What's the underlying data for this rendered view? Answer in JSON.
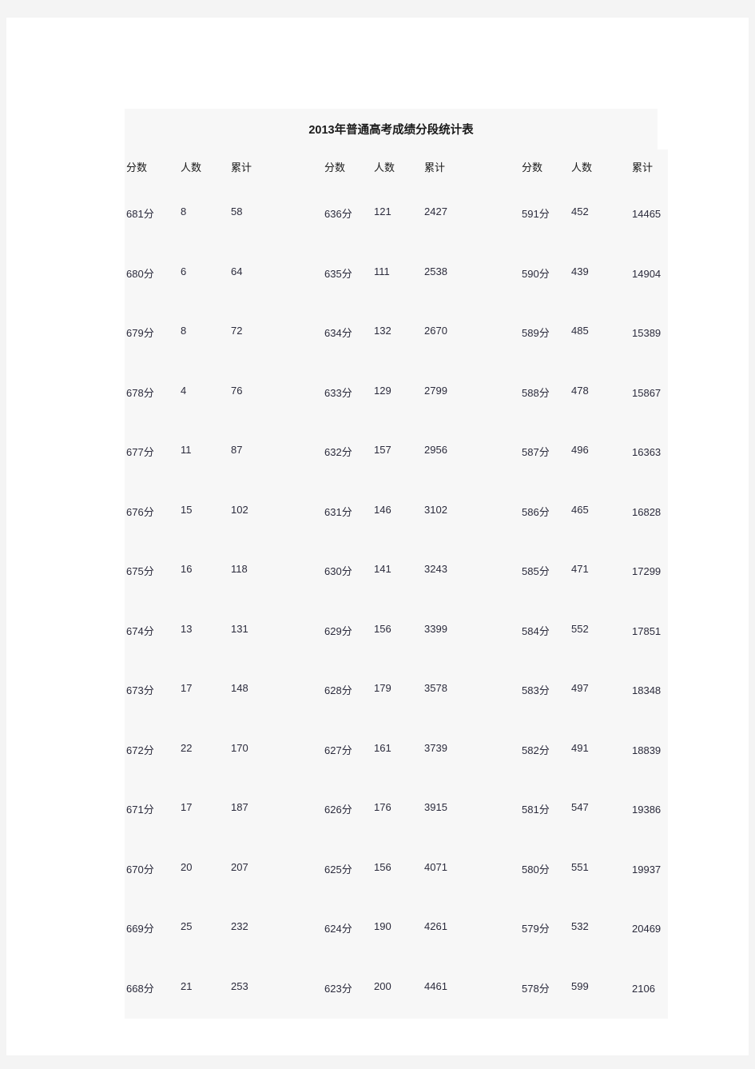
{
  "document": {
    "title": "2013年普通高考成绩分段统计表"
  },
  "table": {
    "headers": [
      "分数",
      "人数",
      "累计",
      "分数",
      "人数",
      "累计",
      "分数",
      "人数",
      "累计"
    ],
    "header_score": "分数",
    "header_count": "人数",
    "header_accum": "累计",
    "rows": [
      {
        "g1_score": "681分",
        "g1_count": "8",
        "g1_accum": "58",
        "g2_score": "636分",
        "g2_count": "121",
        "g2_accum": "2427",
        "g3_score": "591分",
        "g3_count": "452",
        "g3_accum": "14465"
      },
      {
        "g1_score": "680分",
        "g1_count": "6",
        "g1_accum": "64",
        "g2_score": "635分",
        "g2_count": "111",
        "g2_accum": "2538",
        "g3_score": "590分",
        "g3_count": "439",
        "g3_accum": "14904"
      },
      {
        "g1_score": "679分",
        "g1_count": "8",
        "g1_accum": "72",
        "g2_score": "634分",
        "g2_count": "132",
        "g2_accum": "2670",
        "g3_score": "589分",
        "g3_count": "485",
        "g3_accum": "15389"
      },
      {
        "g1_score": "678分",
        "g1_count": "4",
        "g1_accum": "76",
        "g2_score": "633分",
        "g2_count": "129",
        "g2_accum": "2799",
        "g3_score": "588分",
        "g3_count": "478",
        "g3_accum": "15867"
      },
      {
        "g1_score": "677分",
        "g1_count": "11",
        "g1_accum": "87",
        "g2_score": "632分",
        "g2_count": "157",
        "g2_accum": "2956",
        "g3_score": "587分",
        "g3_count": "496",
        "g3_accum": "16363"
      },
      {
        "g1_score": "676分",
        "g1_count": "15",
        "g1_accum": "102",
        "g2_score": "631分",
        "g2_count": "146",
        "g2_accum": "3102",
        "g3_score": "586分",
        "g3_count": "465",
        "g3_accum": "16828"
      },
      {
        "g1_score": "675分",
        "g1_count": "16",
        "g1_accum": "118",
        "g2_score": "630分",
        "g2_count": "141",
        "g2_accum": "3243",
        "g3_score": "585分",
        "g3_count": "471",
        "g3_accum": "17299"
      },
      {
        "g1_score": "674分",
        "g1_count": "13",
        "g1_accum": "131",
        "g2_score": "629分",
        "g2_count": "156",
        "g2_accum": "3399",
        "g3_score": "584分",
        "g3_count": "552",
        "g3_accum": "17851"
      },
      {
        "g1_score": "673分",
        "g1_count": "17",
        "g1_accum": "148",
        "g2_score": "628分",
        "g2_count": "179",
        "g2_accum": "3578",
        "g3_score": "583分",
        "g3_count": "497",
        "g3_accum": "18348"
      },
      {
        "g1_score": "672分",
        "g1_count": "22",
        "g1_accum": "170",
        "g2_score": "627分",
        "g2_count": "161",
        "g2_accum": "3739",
        "g3_score": "582分",
        "g3_count": "491",
        "g3_accum": "18839"
      },
      {
        "g1_score": "671分",
        "g1_count": "17",
        "g1_accum": "187",
        "g2_score": "626分",
        "g2_count": "176",
        "g2_accum": "3915",
        "g3_score": "581分",
        "g3_count": "547",
        "g3_accum": "19386"
      },
      {
        "g1_score": "670分",
        "g1_count": "20",
        "g1_accum": "207",
        "g2_score": "625分",
        "g2_count": "156",
        "g2_accum": "4071",
        "g3_score": "580分",
        "g3_count": "551",
        "g3_accum": "19937"
      },
      {
        "g1_score": "669分",
        "g1_count": "25",
        "g1_accum": "232",
        "g2_score": "624分",
        "g2_count": "190",
        "g2_accum": "4261",
        "g3_score": "579分",
        "g3_count": "532",
        "g3_accum": "20469"
      },
      {
        "g1_score": "668分",
        "g1_count": "21",
        "g1_accum": "253",
        "g2_score": "623分",
        "g2_count": "200",
        "g2_accum": "4461",
        "g3_score": "578分",
        "g3_count": "599",
        "g3_accum": "2106"
      }
    ]
  }
}
